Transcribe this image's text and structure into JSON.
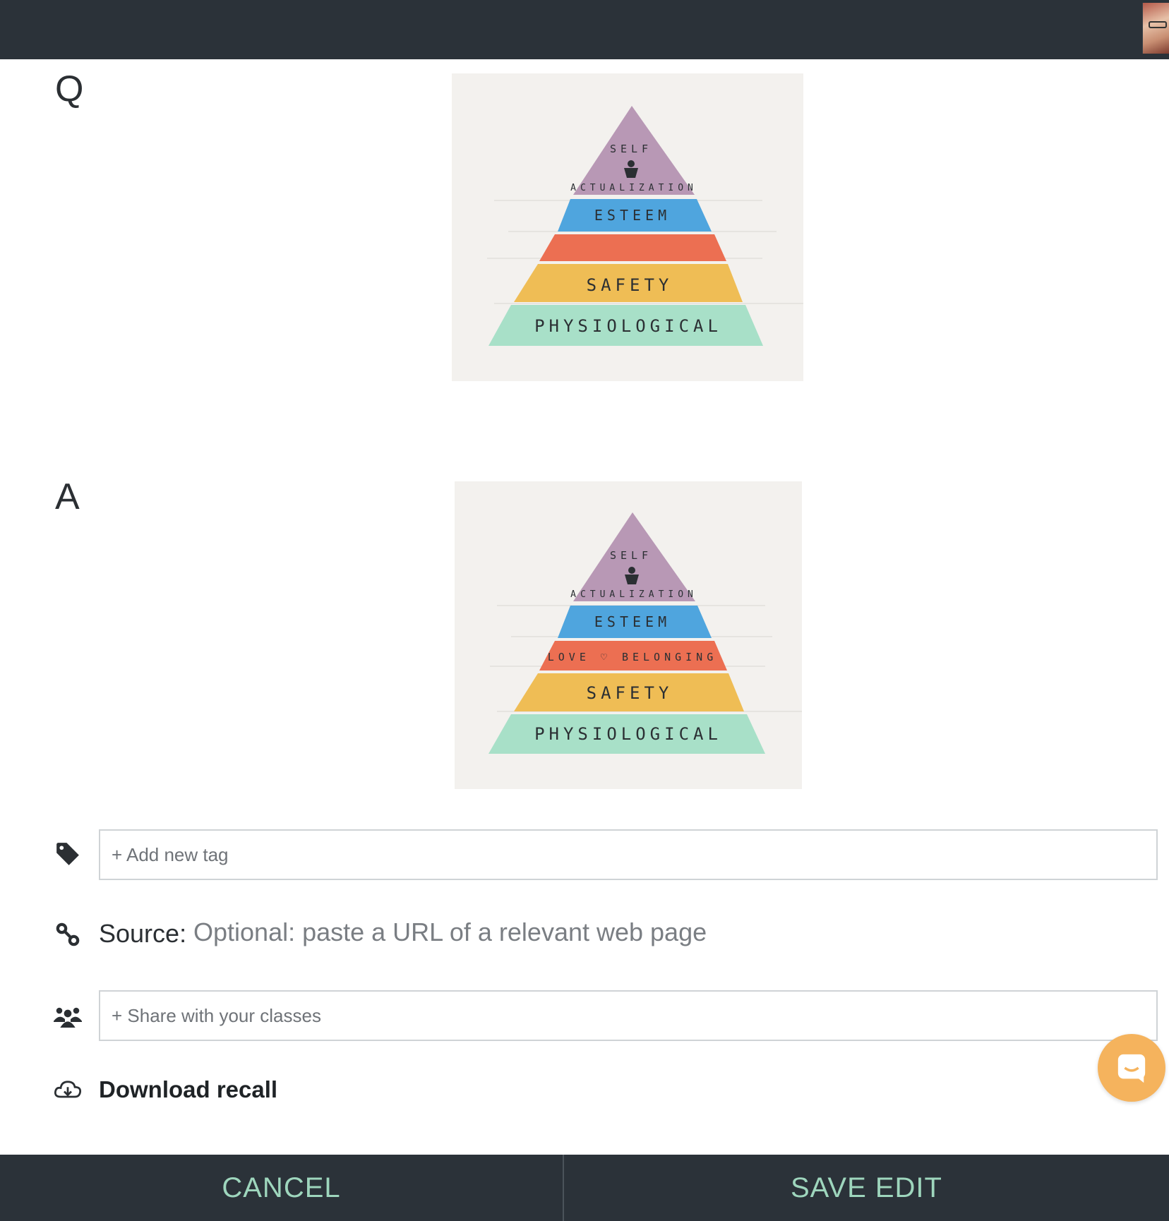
{
  "question": {
    "letter": "Q",
    "pyramid_levels": [
      "SELF",
      "ACTUALIZATION",
      "ESTEEM",
      "",
      "SAFETY",
      "PHYSIOLOGICAL"
    ]
  },
  "answer": {
    "letter": "A",
    "pyramid_levels": [
      "SELF",
      "ACTUALIZATION",
      "ESTEEM",
      "LOVE ♡ BELONGING",
      "SAFETY",
      "PHYSIOLOGICAL"
    ]
  },
  "tags": {
    "placeholder": "+ Add new tag",
    "icon": "tag-icon"
  },
  "source": {
    "label": "Source:",
    "placeholder": "Optional: paste a URL of a relevant web page",
    "icon": "link-icon"
  },
  "share": {
    "placeholder": "+ Share with your classes",
    "icon": "group-icon"
  },
  "download": {
    "label": "Download recall",
    "icon": "cloud-download-icon"
  },
  "footer": {
    "cancel_label": "CANCEL",
    "save_label": "SAVE EDIT"
  },
  "colors": {
    "bar_bg": "#2b3239",
    "button_text": "#9ed6bd",
    "chat_bubble": "#f5b35d",
    "purple": "#b898b5",
    "blue": "#4fa5de",
    "red": "#ec6f52",
    "yellow": "#efbd55",
    "green": "#a8e0c8"
  }
}
